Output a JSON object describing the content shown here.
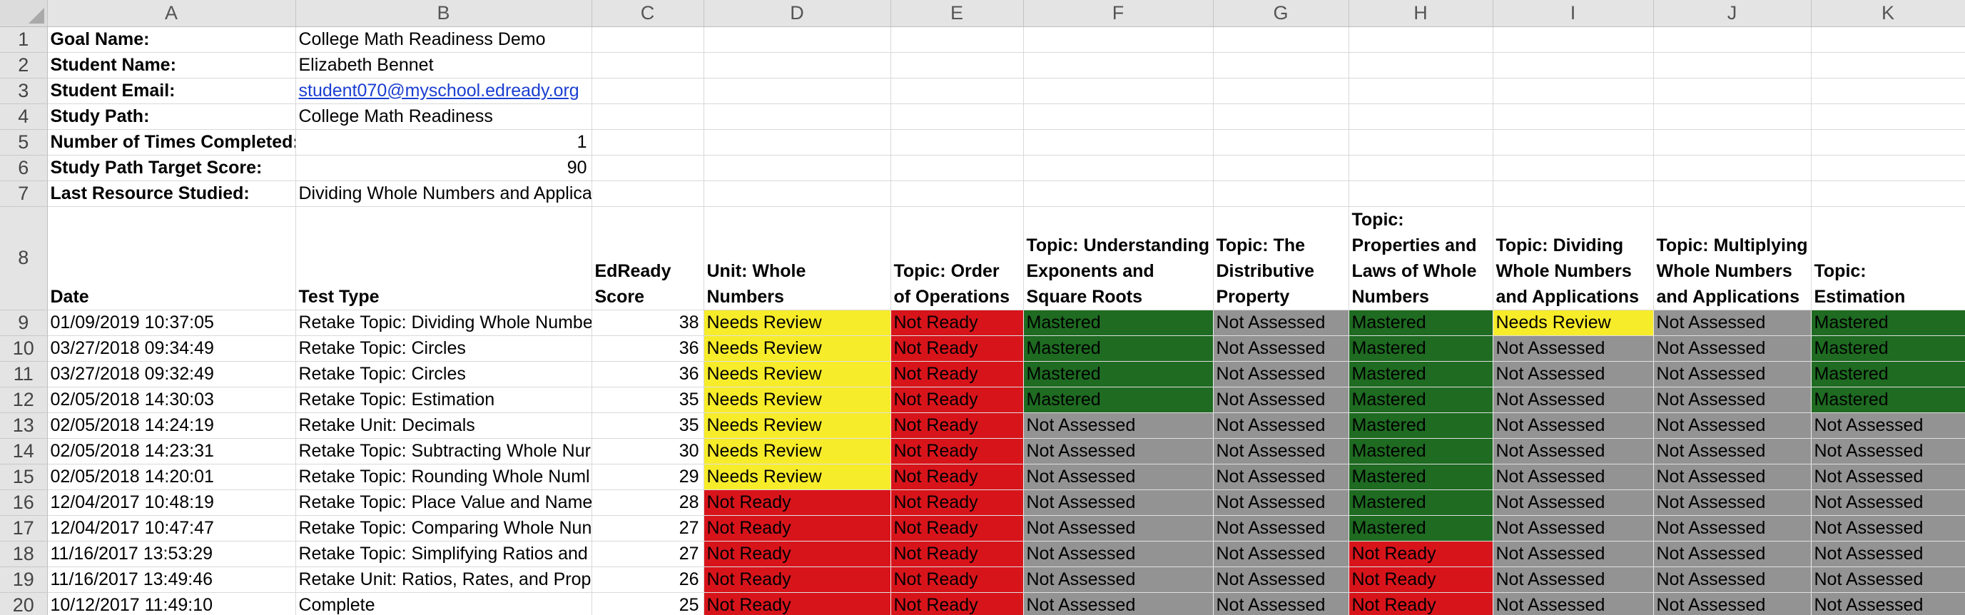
{
  "columns": [
    "A",
    "B",
    "C",
    "D",
    "E",
    "F",
    "G",
    "H",
    "I",
    "J",
    "K"
  ],
  "info": [
    {
      "label": "Goal Name:",
      "value": "College Math Readiness Demo"
    },
    {
      "label": "Student Name:",
      "value": "Elizabeth Bennet"
    },
    {
      "label": "Student Email:",
      "value": "student070@myschool.edready.org"
    },
    {
      "label": "Study Path:",
      "value": "College Math Readiness"
    },
    {
      "label": "Number of Times Completed:",
      "value": "1"
    },
    {
      "label": "Study Path Target Score:",
      "value": "90"
    },
    {
      "label": "Last Resource Studied:",
      "value": "Dividing Whole Numbers and Applications"
    }
  ],
  "headers": [
    "Date",
    "Test Type",
    "EdReady Score",
    "Unit: Whole Numbers",
    "Topic: Order of Operations",
    "Topic: Understanding Exponents and Square Roots",
    "Topic: The Distributive Property",
    "Topic: Properties and Laws of Whole Numbers",
    "Topic: Dividing Whole Numbers and Applications",
    "Topic: Multiplying Whole Numbers and Applications",
    "Topic: Estimation"
  ],
  "status_colors": {
    "Needs Review": "#f7ec2a",
    "Not Ready": "#d8141b",
    "Mastered": "#1e6b21",
    "Not Assessed": "#939393"
  },
  "records": [
    {
      "date": "01/09/2019 10:37:05",
      "test_type": "Retake Topic: Dividing Whole Numbe",
      "score": "38",
      "statuses": [
        "Needs Review",
        "Not Ready",
        "Mastered",
        "Not Assessed",
        "Mastered",
        "Needs Review",
        "Not Assessed",
        "Mastered"
      ]
    },
    {
      "date": "03/27/2018 09:34:49",
      "test_type": "Retake Topic: Circles",
      "score": "36",
      "statuses": [
        "Needs Review",
        "Not Ready",
        "Mastered",
        "Not Assessed",
        "Mastered",
        "Not Assessed",
        "Not Assessed",
        "Mastered"
      ]
    },
    {
      "date": "03/27/2018 09:32:49",
      "test_type": "Retake Topic: Circles",
      "score": "36",
      "statuses": [
        "Needs Review",
        "Not Ready",
        "Mastered",
        "Not Assessed",
        "Mastered",
        "Not Assessed",
        "Not Assessed",
        "Mastered"
      ]
    },
    {
      "date": "02/05/2018 14:30:03",
      "test_type": "Retake Topic: Estimation",
      "score": "35",
      "statuses": [
        "Needs Review",
        "Not Ready",
        "Mastered",
        "Not Assessed",
        "Mastered",
        "Not Assessed",
        "Not Assessed",
        "Mastered"
      ]
    },
    {
      "date": "02/05/2018 14:24:19",
      "test_type": "Retake Unit: Decimals",
      "score": "35",
      "statuses": [
        "Needs Review",
        "Not Ready",
        "Not Assessed",
        "Not Assessed",
        "Mastered",
        "Not Assessed",
        "Not Assessed",
        "Not Assessed"
      ]
    },
    {
      "date": "02/05/2018 14:23:31",
      "test_type": "Retake Topic: Subtracting Whole Nur",
      "score": "30",
      "statuses": [
        "Needs Review",
        "Not Ready",
        "Not Assessed",
        "Not Assessed",
        "Mastered",
        "Not Assessed",
        "Not Assessed",
        "Not Assessed"
      ]
    },
    {
      "date": "02/05/2018 14:20:01",
      "test_type": "Retake Topic: Rounding Whole Numl",
      "score": "29",
      "statuses": [
        "Needs Review",
        "Not Ready",
        "Not Assessed",
        "Not Assessed",
        "Mastered",
        "Not Assessed",
        "Not Assessed",
        "Not Assessed"
      ]
    },
    {
      "date": "12/04/2017 10:48:19",
      "test_type": "Retake Topic: Place Value and Name:",
      "score": "28",
      "statuses": [
        "Not Ready",
        "Not Ready",
        "Not Assessed",
        "Not Assessed",
        "Mastered",
        "Not Assessed",
        "Not Assessed",
        "Not Assessed"
      ]
    },
    {
      "date": "12/04/2017 10:47:47",
      "test_type": "Retake Topic: Comparing Whole Nun",
      "score": "27",
      "statuses": [
        "Not Ready",
        "Not Ready",
        "Not Assessed",
        "Not Assessed",
        "Mastered",
        "Not Assessed",
        "Not Assessed",
        "Not Assessed"
      ]
    },
    {
      "date": "11/16/2017 13:53:29",
      "test_type": "Retake Topic: Simplifying Ratios and",
      "score": "27",
      "statuses": [
        "Not Ready",
        "Not Ready",
        "Not Assessed",
        "Not Assessed",
        "Not Ready",
        "Not Assessed",
        "Not Assessed",
        "Not Assessed"
      ]
    },
    {
      "date": "11/16/2017 13:49:46",
      "test_type": "Retake Unit: Ratios, Rates, and Propo",
      "score": "26",
      "statuses": [
        "Not Ready",
        "Not Ready",
        "Not Assessed",
        "Not Assessed",
        "Not Ready",
        "Not Assessed",
        "Not Assessed",
        "Not Assessed"
      ]
    },
    {
      "date": "10/12/2017 11:49:10",
      "test_type": "Complete",
      "score": "25",
      "statuses": [
        "Not Ready",
        "Not Ready",
        "Not Assessed",
        "Not Assessed",
        "Not Ready",
        "Not Assessed",
        "Not Assessed",
        "Not Assessed"
      ]
    }
  ]
}
